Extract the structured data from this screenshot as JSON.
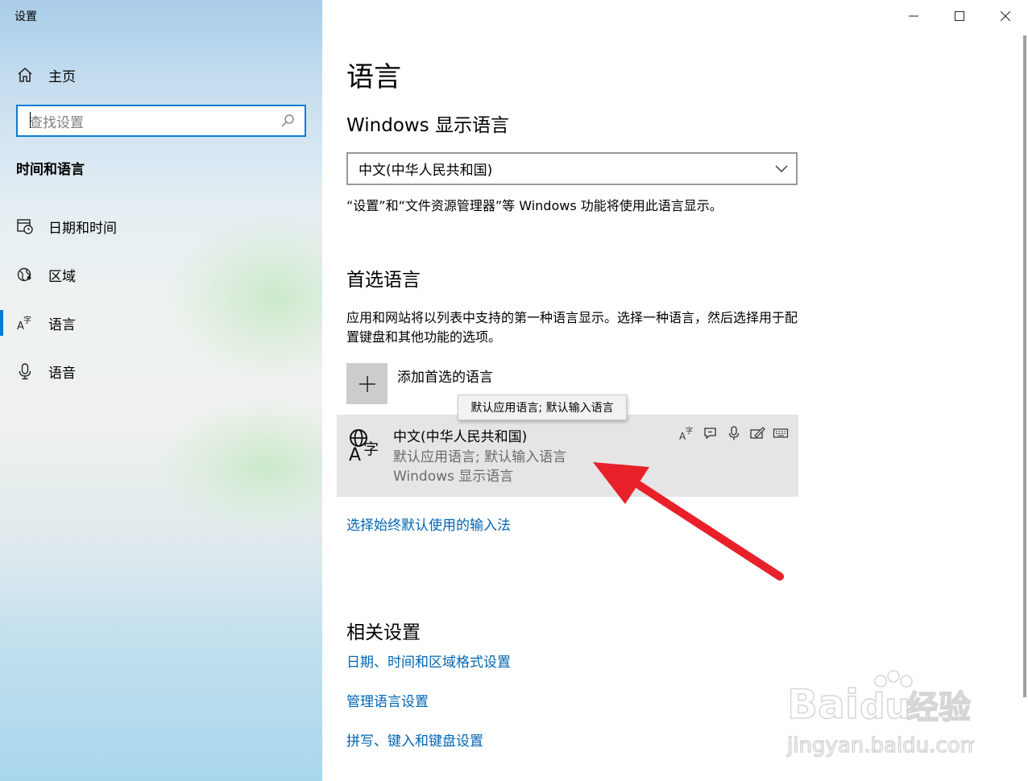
{
  "window": {
    "title": "设置"
  },
  "sidebar": {
    "home_label": "主页",
    "search_placeholder": "查找设置",
    "section_title": "时间和语言",
    "items": [
      {
        "label": "日期和时间",
        "icon": "calendar-clock-icon",
        "active": false
      },
      {
        "label": "区域",
        "icon": "globe-region-icon",
        "active": false
      },
      {
        "label": "语言",
        "icon": "language-icon",
        "active": true
      },
      {
        "label": "语音",
        "icon": "microphone-icon",
        "active": false
      }
    ]
  },
  "main": {
    "title": "语言",
    "display_language": {
      "heading": "Windows 显示语言",
      "selected": "中文(中华人民共和国)",
      "note": "“设置”和“文件资源管理器”等 Windows 功能将使用此语言显示。"
    },
    "preferred": {
      "heading": "首选语言",
      "description": "应用和网站将以列表中支持的第一种语言显示。选择一种语言，然后选择用于配置键盘和其他功能的选项。",
      "add_label": "添加首选的语言",
      "tooltip": "默认应用语言; 默认输入语言",
      "item": {
        "name": "中文(中华人民共和国)",
        "line1": "默认应用语言; 默认输入语言",
        "line2": "Windows 显示语言",
        "feature_icons": [
          "language-pack-icon",
          "speech-bubble-icon",
          "microphone-icon",
          "handwriting-icon",
          "keyboard-icon"
        ]
      },
      "input_method_link": "选择始终默认使用的输入法"
    },
    "related": {
      "heading": "相关设置",
      "links": [
        "日期、时间和区域格式设置",
        "管理语言设置",
        "拼写、键入和键盘设置"
      ]
    }
  },
  "watermark": {
    "brand": "Baidu经验",
    "url": "jingyan.baidu.com"
  },
  "colors": {
    "accent": "#0b78d4",
    "link": "#0066b4",
    "selected_item_bg": "#e5e5e5",
    "annotation_arrow": "#e8202a"
  }
}
